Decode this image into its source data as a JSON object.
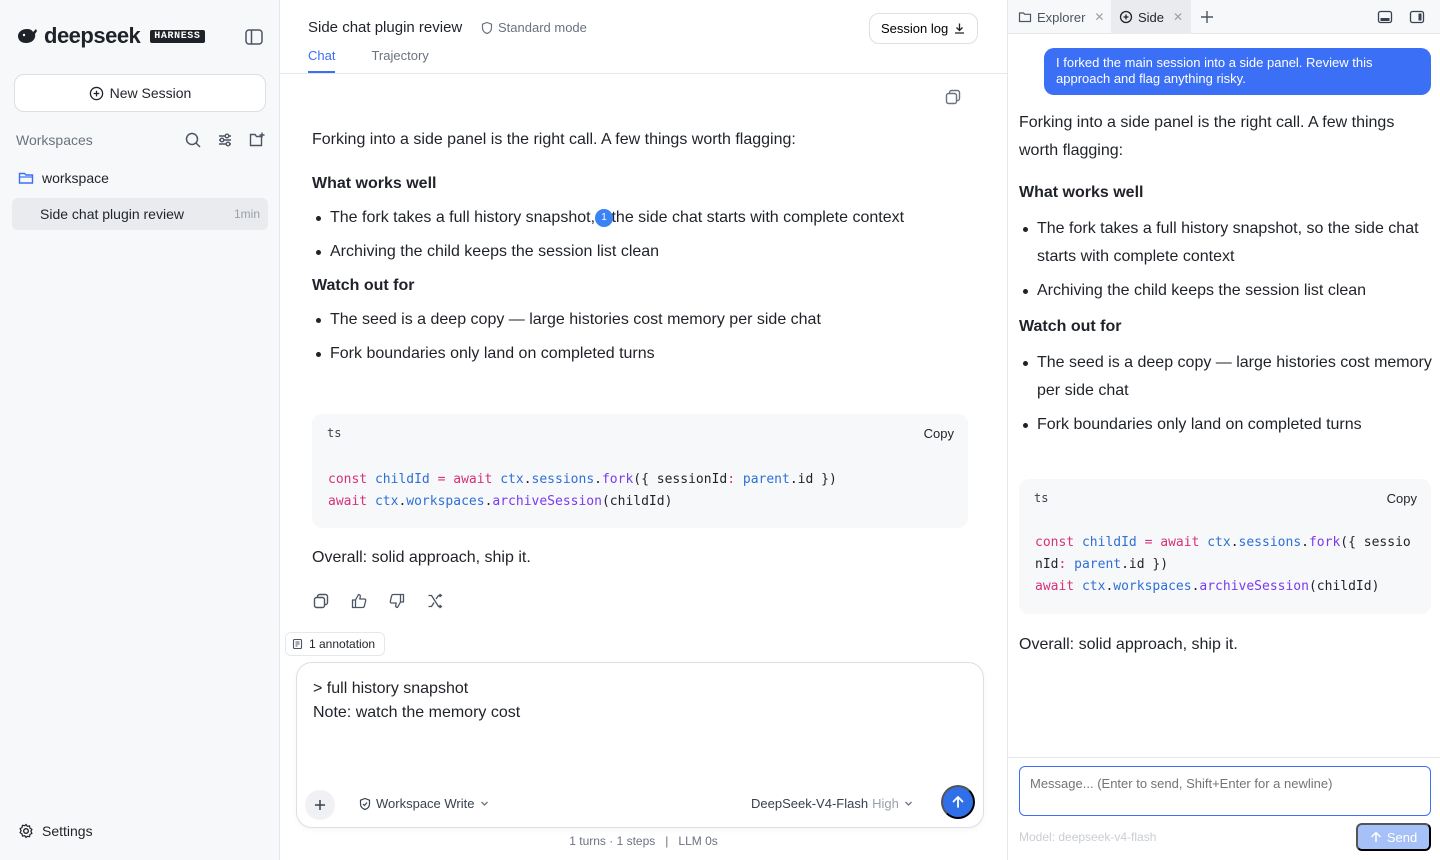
{
  "sidebar": {
    "logo_text": "deepseek",
    "logo_badge": "HARNESS",
    "new_session_label": "New Session",
    "workspaces_label": "Workspaces",
    "workspace_name": "workspace",
    "sessions": [
      {
        "name": "Side chat plugin review",
        "age": "1min"
      }
    ],
    "settings_label": "Settings"
  },
  "main": {
    "title": "Side chat plugin review",
    "mode": "Standard mode",
    "session_log_label": "Session log",
    "tabs": [
      {
        "label": "Chat",
        "active": true
      },
      {
        "label": "Trajectory",
        "active": false
      }
    ],
    "answer": {
      "intro": "Forking into a side panel is the right call. A few things worth flagging:",
      "works_heading": "What works well",
      "works_1a": "The fork takes a full history snapshot,",
      "annotation_number": "1",
      "works_1b": "the side chat starts with complete context",
      "works_2": "Archiving the child keeps the session list clean",
      "watch_heading": "Watch out for",
      "watch_1": "The seed is a deep copy — large histories cost memory per side chat",
      "watch_2": "Fork boundaries only land on completed turns",
      "code_lang": "ts",
      "code_copy": "Copy",
      "overall": "Overall: solid approach, ship it."
    },
    "annotation_chip": "1 annotation",
    "composer": {
      "line1": "> full history snapshot",
      "line2": "Note: watch the memory cost",
      "permission": "Workspace Write",
      "model": "DeepSeek-V4-Flash",
      "effort": "High"
    },
    "stats": "1 turns · 1 steps   |   LLM 0s"
  },
  "side": {
    "tabs": [
      {
        "label": "Explorer",
        "active": false
      },
      {
        "label": "Side",
        "active": true
      }
    ],
    "user_message": "I forked the main session into a side panel. Review this approach and flag anything risky.",
    "answer": {
      "intro": "Forking into a side panel is the right call. A few things worth flagging:",
      "works_heading": "What works well",
      "works_1": "The fork takes a full history snapshot, so the side chat starts with complete context",
      "works_2": "Archiving the child keeps the session list clean",
      "watch_heading": "Watch out for",
      "watch_1": "The seed is a deep copy — large histories cost memory per side chat",
      "watch_2": "Fork boundaries only land on completed turns",
      "code_lang": "ts",
      "code_copy": "Copy",
      "overall": "Overall: solid approach, ship it."
    },
    "input_placeholder": "Message... (Enter to send, Shift+Enter for a newline)",
    "model_label": "Model: deepseek-v4-flash",
    "send_label": "Send"
  },
  "colors": {
    "accent": "#3b6ff5",
    "send_button": "#2f6fe8",
    "keyword": "#d7317a",
    "variable": "#2f6fd6",
    "method": "#7c3aed"
  },
  "icons": {
    "logo": "whale-icon",
    "collapse": "sidebar-toggle-icon",
    "new": "plus-circle-icon",
    "search": "search-icon",
    "filter": "sliders-icon",
    "new_folder": "folder-plus-icon",
    "folder": "folder-icon",
    "settings": "gear-icon",
    "mode": "shield-icon",
    "download": "download-icon",
    "copy": "copy-icon",
    "like": "thumbs-up-icon",
    "dislike": "thumbs-down-icon",
    "branch": "branch-icon",
    "send": "arrow-up-icon"
  }
}
